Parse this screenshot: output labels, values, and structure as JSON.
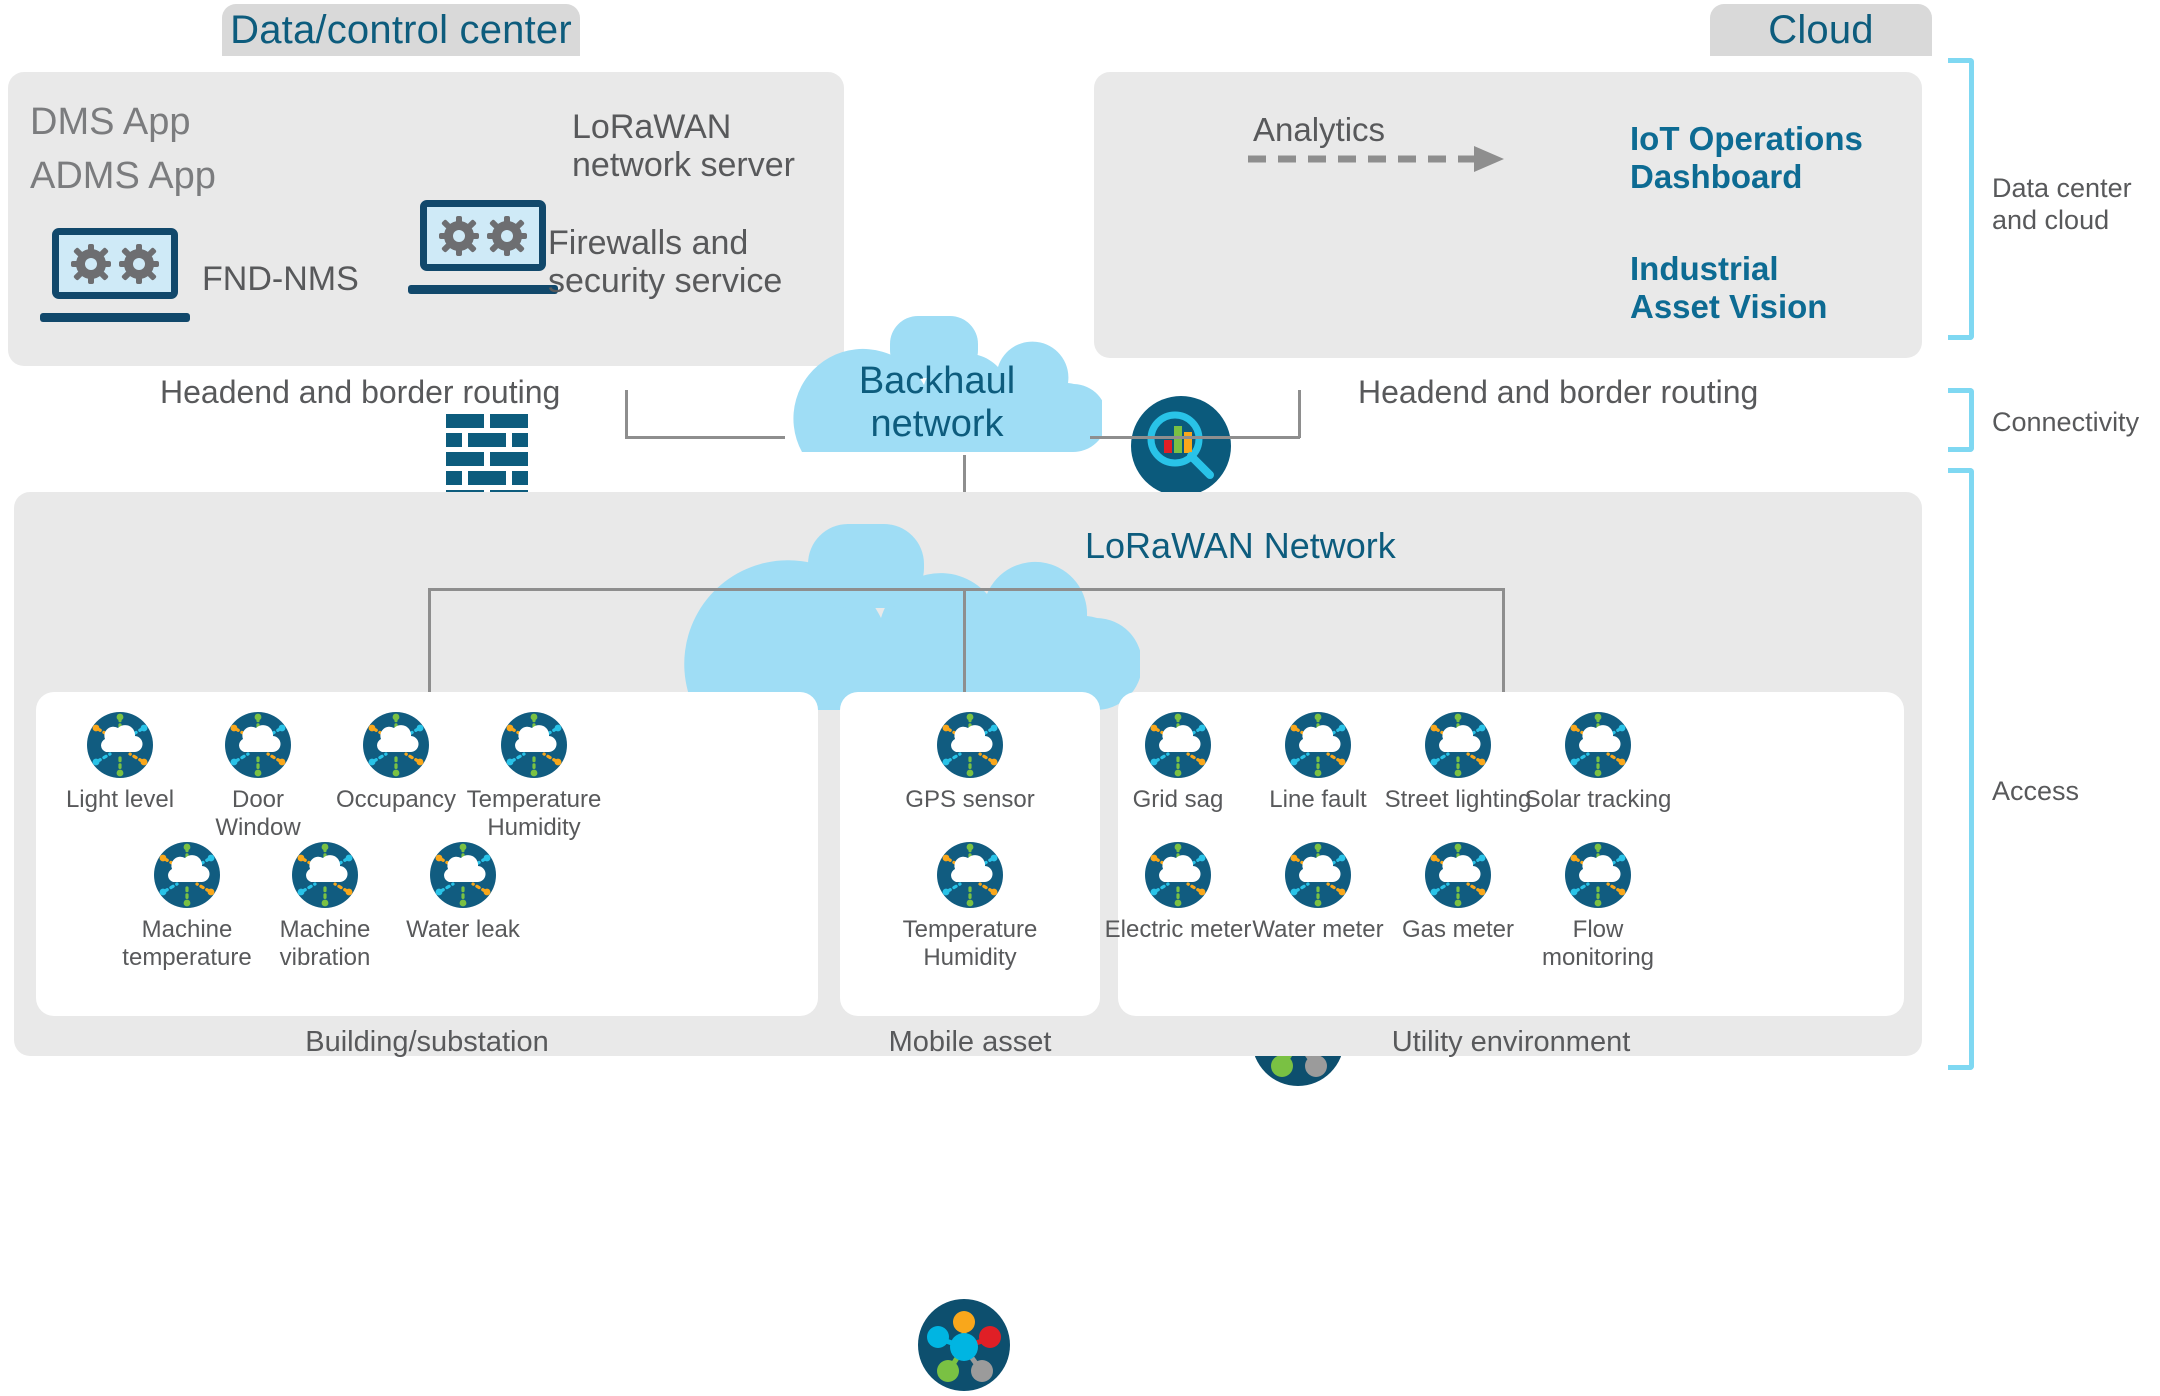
{
  "tabs": [
    {
      "id": "data-control-center",
      "label": "Data/control center"
    },
    {
      "id": "cloud",
      "label": "Cloud"
    }
  ],
  "datacenter_panel": {
    "apps": [
      "DMS App",
      "ADMS App"
    ],
    "items": [
      {
        "icon": "laptop-icon",
        "label": "FND-NMS"
      },
      {
        "icon": "laptop-icon",
        "label": "LoRaWAN\nnetwork server"
      },
      {
        "icon": "firewall-icon",
        "label": "Firewalls and\nsecurity service"
      }
    ]
  },
  "cloud_panel": {
    "analytics_label": "Analytics",
    "items": [
      {
        "icon": "cloud-dashboard-icon",
        "label": "IoT Operations\nDashboard"
      },
      {
        "icon": "laptop-icon",
        "label": "Industrial\nAsset Vision"
      }
    ]
  },
  "headend": {
    "left_label": "Headend and border routing",
    "right_label": "Headend and border routing"
  },
  "backhaul": {
    "label_line1": "Backhaul",
    "label_line2": "network"
  },
  "lorawan": {
    "label": "LoRaWAN Network"
  },
  "brackets": [
    {
      "id": "data-center-and-cloud",
      "label": "Data center\nand cloud"
    },
    {
      "id": "connectivity",
      "label": "Connectivity"
    },
    {
      "id": "access",
      "label": "Access"
    }
  ],
  "access_zones": [
    {
      "id": "building-substation",
      "label": "Building/substation",
      "row1": [
        "Light level",
        "Door\nWindow",
        "Occupancy",
        "Temperature\nHumidity"
      ],
      "row2": [
        "Machine\ntemperature",
        "Machine\nvibration",
        "Water leak"
      ]
    },
    {
      "id": "mobile-asset",
      "label": "Mobile asset",
      "row1": [
        "GPS sensor"
      ],
      "row2": [
        "Temperature\nHumidity"
      ]
    },
    {
      "id": "utility-environment",
      "label": "Utility environment",
      "row1": [
        "Grid sag",
        "Line fault",
        "Street lighting",
        "Solar tracking"
      ],
      "row2": [
        "Electric meter",
        "Water meter",
        "Gas meter",
        "Flow\nmonitoring"
      ]
    }
  ],
  "colors": {
    "panel_grey": "#e9e9e9",
    "tab_grey": "#d9d9d9",
    "deep_blue": "#0d5c7d",
    "cyan": "#00b5e2",
    "light_cloud": "#9fddf5",
    "bracket": "#7fd8f2",
    "text_grey": "#58595b",
    "node_orange": "#f9a71b",
    "node_red": "#e01f26",
    "node_green": "#7ac143",
    "node_gray": "#9b9b9b",
    "node_cyan": "#00b5e2"
  }
}
